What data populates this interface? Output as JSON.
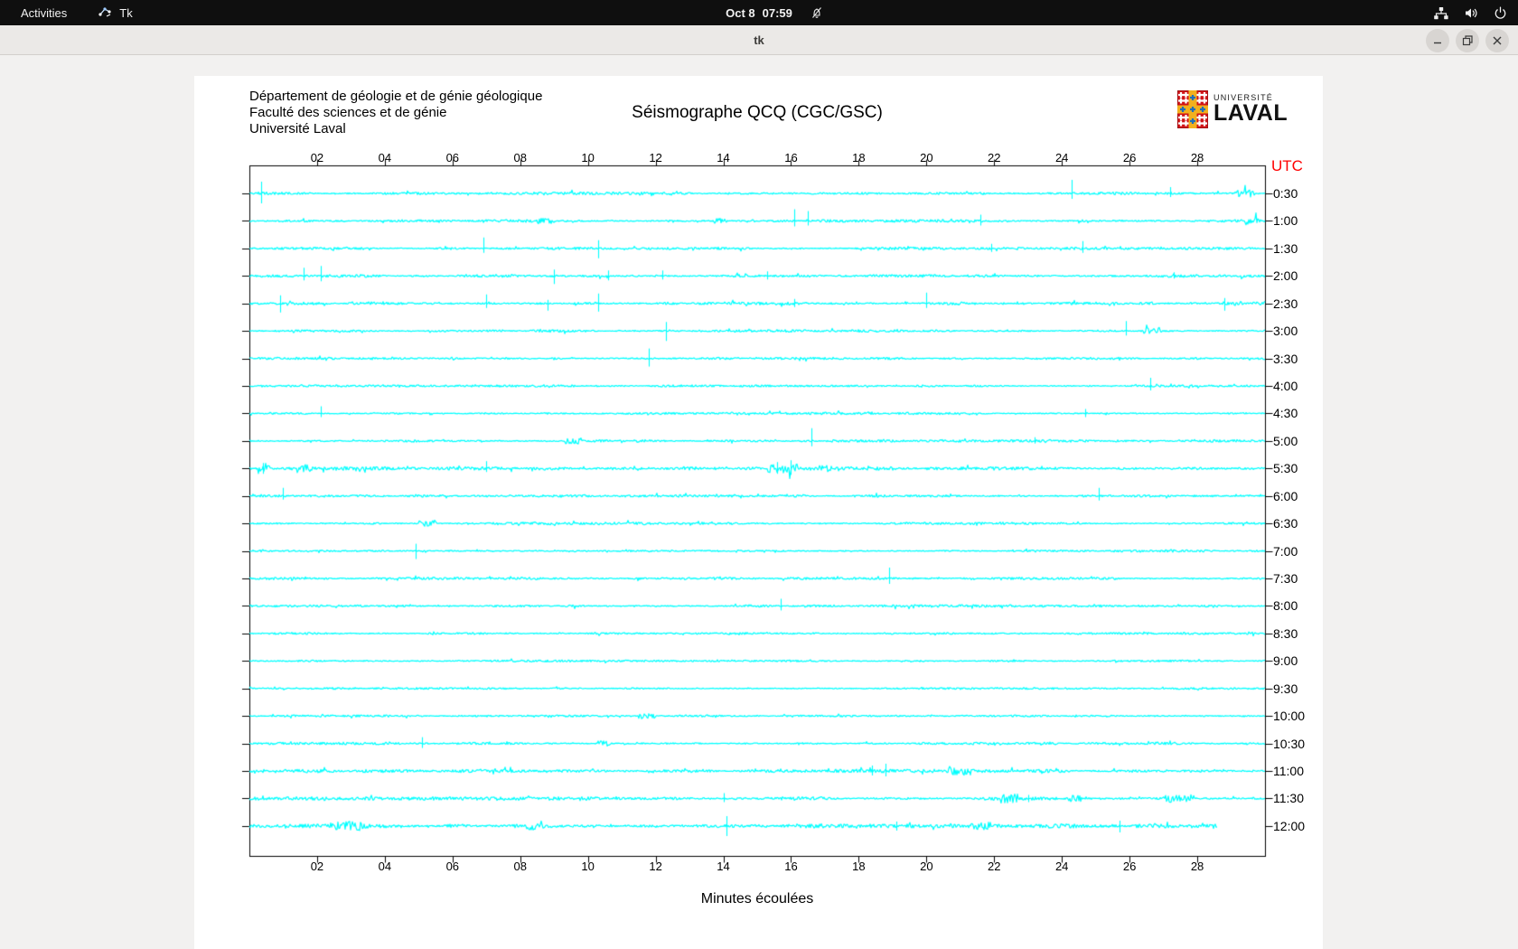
{
  "system_bar": {
    "activities_label": "Activities",
    "app_name": "Tk",
    "clock": {
      "date": "Oct 8",
      "time": "07:59"
    },
    "notifications_icon": "bell-slash-icon",
    "tray_icons": [
      "network-nodes-icon",
      "volume-icon",
      "power-icon"
    ]
  },
  "window": {
    "title": "tk",
    "controls": [
      "minimize",
      "maximize",
      "close"
    ]
  },
  "plot": {
    "header_lines": [
      "Département de géologie et de génie géologique",
      "Faculté des sciences et de génie",
      "Université Laval"
    ],
    "title": "Séismographe QCQ (CGC/GSC)",
    "utc_label": "UTC",
    "xlabel": "Minutes écoulées",
    "logo": {
      "line1": "UNIVERSITÉ",
      "line2": "LAVAL"
    },
    "colors": {
      "trace": "#00ffff",
      "axis": "#000000",
      "utc": "#ff0000",
      "logo_red": "#d01317",
      "logo_gold": "#f2b01e",
      "logo_blue": "#1e6fba"
    },
    "chart_data": {
      "type": "line",
      "subtype": "helicorder-seismogram",
      "station": "QCQ (CGC/GSC)",
      "x_axis": {
        "label": "Minutes écoulées",
        "range": [
          0,
          30
        ],
        "tick_labels": [
          "02",
          "04",
          "06",
          "08",
          "10",
          "12",
          "14",
          "16",
          "18",
          "20",
          "22",
          "24",
          "26",
          "28"
        ]
      },
      "y_axis": {
        "label": "UTC",
        "interval_minutes": 30
      },
      "trace_color": "#00ffff",
      "rows": [
        {
          "label": "0:30",
          "noise": 1.0,
          "end": 30,
          "spikes": [
            [
              0.35,
              13,
              11
            ],
            [
              24.3,
              15,
              6
            ],
            [
              27.2,
              7,
              4
            ]
          ],
          "blobs": [
            [
              29.1,
              0.6,
              3.5
            ]
          ]
        },
        {
          "label": "1:00",
          "noise": 1.0,
          "end": 30,
          "spikes": [
            [
              16.1,
              13,
              6
            ],
            [
              16.5,
              11,
              5
            ],
            [
              21.6,
              7,
              5
            ]
          ],
          "blobs": [
            [
              8.5,
              0.5,
              2.5
            ],
            [
              13.7,
              0.4,
              2.5
            ],
            [
              29.4,
              0.4,
              2.5
            ]
          ]
        },
        {
          "label": "1:30",
          "noise": 0.9,
          "end": 30,
          "spikes": [
            [
              6.9,
              12,
              5
            ],
            [
              10.3,
              9,
              11
            ],
            [
              21.9,
              5,
              4
            ],
            [
              24.6,
              8,
              5
            ]
          ],
          "blobs": []
        },
        {
          "label": "2:00",
          "noise": 1.0,
          "end": 30,
          "spikes": [
            [
              1.6,
              9,
              5
            ],
            [
              2.1,
              11,
              6
            ],
            [
              9.0,
              7,
              9
            ],
            [
              10.6,
              6,
              5
            ],
            [
              12.2,
              6,
              4
            ],
            [
              15.3,
              5,
              4
            ],
            [
              27.3,
              4,
              3
            ]
          ],
          "blobs": []
        },
        {
          "label": "2:30",
          "noise": 1.1,
          "end": 30,
          "spikes": [
            [
              0.9,
              9,
              10
            ],
            [
              7.0,
              10,
              5
            ],
            [
              8.8,
              4,
              8
            ],
            [
              10.3,
              11,
              9
            ],
            [
              16.1,
              5,
              4
            ],
            [
              20.0,
              12,
              5
            ],
            [
              28.8,
              6,
              8
            ]
          ],
          "blobs": []
        },
        {
          "label": "3:00",
          "noise": 0.9,
          "end": 30,
          "spikes": [
            [
              12.3,
              10,
              11
            ],
            [
              25.9,
              11,
              5
            ]
          ],
          "blobs": [
            [
              26.4,
              0.5,
              3
            ]
          ]
        },
        {
          "label": "3:30",
          "noise": 0.8,
          "end": 30,
          "spikes": [
            [
              11.8,
              11,
              9
            ]
          ],
          "blobs": []
        },
        {
          "label": "4:00",
          "noise": 0.8,
          "end": 30,
          "spikes": [
            [
              26.6,
              9,
              5
            ]
          ],
          "blobs": []
        },
        {
          "label": "4:30",
          "noise": 0.8,
          "end": 30,
          "spikes": [
            [
              2.1,
              8,
              4
            ],
            [
              24.7,
              5,
              4
            ]
          ],
          "blobs": []
        },
        {
          "label": "5:00",
          "noise": 0.9,
          "end": 30,
          "spikes": [
            [
              16.6,
              14,
              6
            ],
            [
              23.2,
              4,
              3
            ]
          ],
          "blobs": [
            [
              9.3,
              0.5,
              2.5
            ]
          ]
        },
        {
          "label": "5:30",
          "noise": 1.2,
          "end": 30,
          "spikes": [
            [
              0.4,
              6,
              6
            ],
            [
              7.0,
              8,
              4
            ],
            [
              15.6,
              7,
              6
            ],
            [
              16.0,
              9,
              7
            ]
          ],
          "blobs": [
            [
              0.2,
              0.4,
              3
            ],
            [
              1.4,
              0.5,
              3
            ],
            [
              15.3,
              0.9,
              4
            ],
            [
              16.8,
              0.4,
              2.5
            ]
          ]
        },
        {
          "label": "6:00",
          "noise": 0.9,
          "end": 30,
          "spikes": [
            [
              1.0,
              9,
              4
            ],
            [
              25.1,
              9,
              5
            ]
          ],
          "blobs": []
        },
        {
          "label": "6:30",
          "noise": 0.9,
          "end": 30,
          "spikes": [],
          "blobs": [
            [
              5.0,
              0.5,
              3
            ]
          ]
        },
        {
          "label": "7:00",
          "noise": 0.8,
          "end": 30,
          "spikes": [
            [
              4.9,
              8,
              9
            ]
          ],
          "blobs": []
        },
        {
          "label": "7:30",
          "noise": 0.9,
          "end": 30,
          "spikes": [
            [
              18.9,
              12,
              6
            ]
          ],
          "blobs": []
        },
        {
          "label": "8:00",
          "noise": 0.9,
          "end": 30,
          "spikes": [
            [
              15.7,
              8,
              5
            ]
          ],
          "blobs": []
        },
        {
          "label": "8:30",
          "noise": 0.7,
          "end": 30,
          "spikes": [],
          "blobs": []
        },
        {
          "label": "9:00",
          "noise": 0.7,
          "end": 30,
          "spikes": [],
          "blobs": []
        },
        {
          "label": "9:30",
          "noise": 0.7,
          "end": 30,
          "spikes": [],
          "blobs": []
        },
        {
          "label": "10:00",
          "noise": 0.8,
          "end": 30,
          "spikes": [],
          "blobs": [
            [
              11.5,
              0.5,
              2.5
            ]
          ]
        },
        {
          "label": "10:30",
          "noise": 0.9,
          "end": 30,
          "spikes": [
            [
              5.1,
              7,
              5
            ]
          ],
          "blobs": [
            [
              10.3,
              0.4,
              2.5
            ]
          ]
        },
        {
          "label": "11:00",
          "noise": 1.2,
          "end": 30,
          "spikes": [
            [
              18.4,
              6,
              5
            ],
            [
              18.8,
              8,
              6
            ]
          ],
          "blobs": [
            [
              20.6,
              0.7,
              3.5
            ]
          ]
        },
        {
          "label": "11:30",
          "noise": 1.3,
          "end": 30,
          "spikes": [
            [
              14.0,
              6,
              4
            ],
            [
              23.0,
              4,
              4
            ]
          ],
          "blobs": [
            [
              22.2,
              0.5,
              3.5
            ],
            [
              24.2,
              0.4,
              3
            ],
            [
              27.0,
              0.9,
              4
            ]
          ]
        },
        {
          "label": "12:00",
          "noise": 1.5,
          "end": 28.6,
          "spikes": [
            [
              14.1,
              11,
              11
            ],
            [
              19.1,
              5,
              5
            ],
            [
              25.7,
              6,
              7
            ]
          ],
          "blobs": [
            [
              2.4,
              1.3,
              3
            ],
            [
              8.1,
              0.5,
              2.5
            ],
            [
              21.3,
              0.6,
              3
            ]
          ]
        }
      ]
    }
  }
}
